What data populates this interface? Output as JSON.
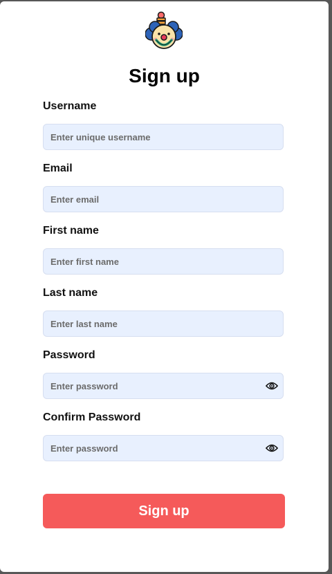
{
  "modal": {
    "title": "Sign up",
    "fields": [
      {
        "label": "Username",
        "placeholder": "Enter unique username"
      },
      {
        "label": "Email",
        "placeholder": "Enter email"
      },
      {
        "label": "First name",
        "placeholder": "Enter first name"
      },
      {
        "label": "Last name",
        "placeholder": "Enter last name"
      },
      {
        "label": "Password",
        "placeholder": "Enter password",
        "icon": "eye-icon"
      },
      {
        "label": "Confirm Password",
        "placeholder": "Enter password",
        "icon": "eye-icon"
      }
    ],
    "submit_label": "Sign up"
  },
  "colors": {
    "input_background": "#e8f0fe",
    "submit_background": "#f55a5a",
    "overlay": "#3a3a3a"
  },
  "logo": {
    "icon": "clown-logo-icon"
  }
}
